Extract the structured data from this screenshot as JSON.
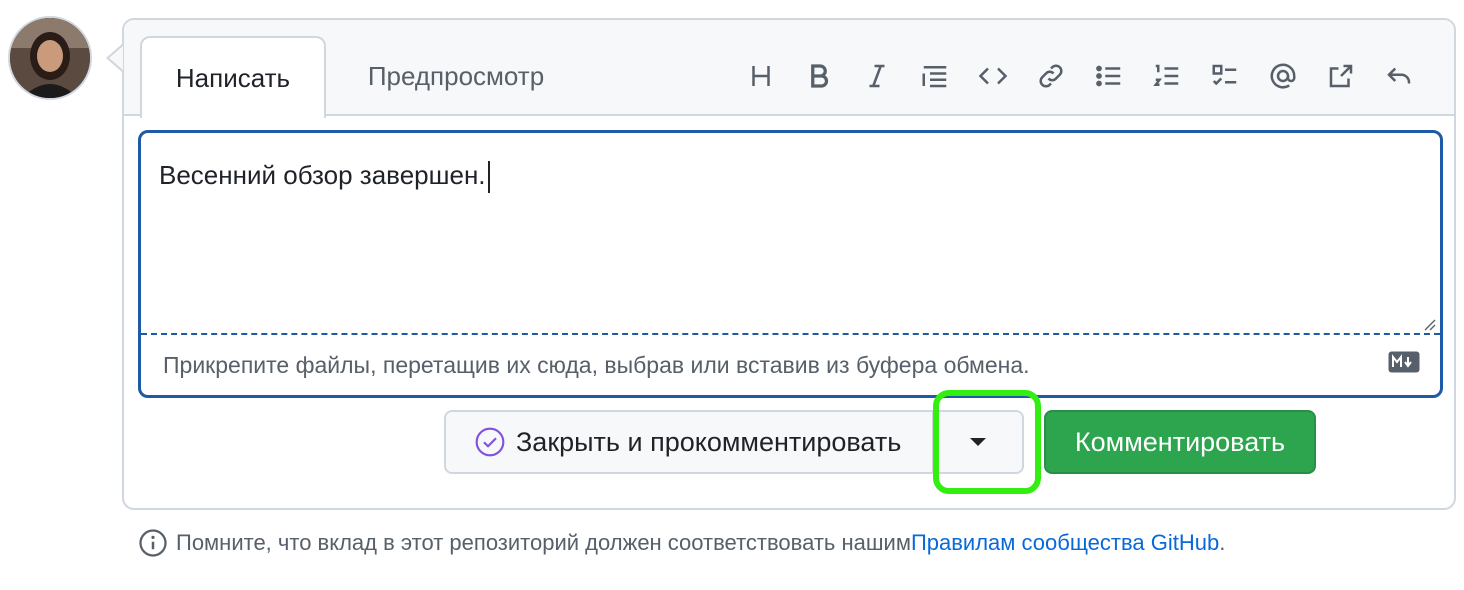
{
  "tabs": {
    "write": "Написать",
    "preview": "Предпросмотр"
  },
  "toolbar": [
    "heading-icon",
    "bold-icon",
    "italic-icon",
    "quote-icon",
    "code-icon",
    "link-icon",
    "bulleted-list-icon",
    "numbered-list-icon",
    "task-list-icon",
    "mention-icon",
    "cross-reference-icon",
    "reply-icon"
  ],
  "editor": {
    "text": "Весенний обзор завершен.",
    "attach_hint": "Прикрепите файлы, перетащив их сюда, выбрав или вставив из буфера обмена."
  },
  "actions": {
    "close_comment": "Закрыть и прокомментировать",
    "comment": "Комментировать"
  },
  "footer": {
    "text": "Помните, что вклад в этот репозиторий должен соответствовать нашим ",
    "link": "Правилам сообщества GitHub",
    "end": "."
  },
  "colors": {
    "accent": "#1f5aa6",
    "primary": "#2da44e",
    "highlight": "#33ee11",
    "link": "#0969da",
    "closed_icon": "#8250df"
  }
}
